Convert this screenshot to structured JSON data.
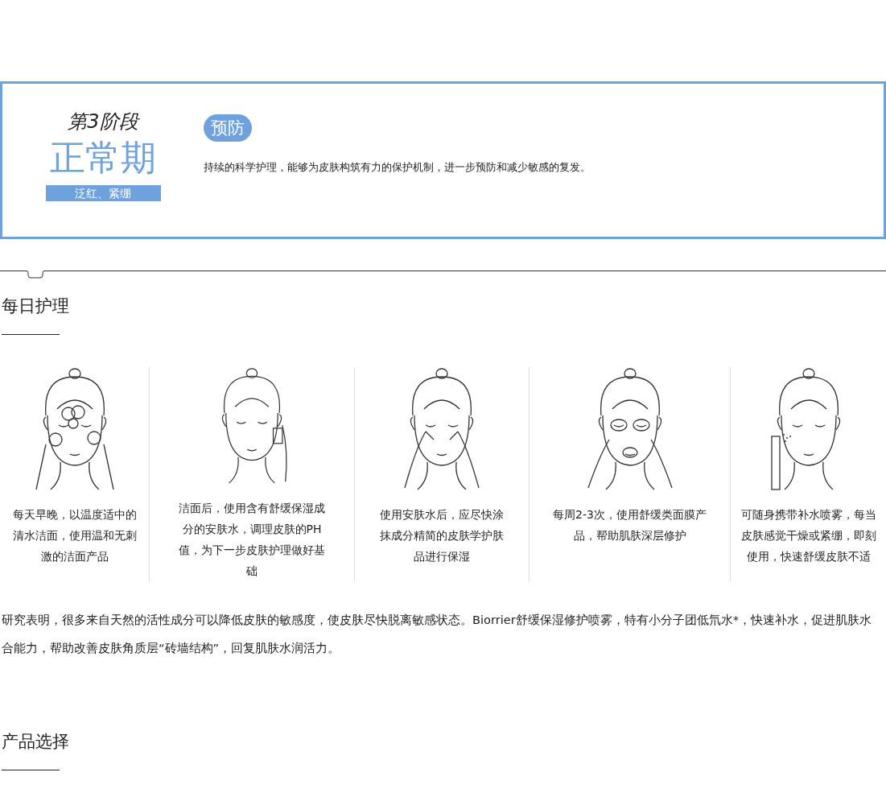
{
  "stage_card": {
    "stage_label": "第3阶段",
    "phase_title": "正常期",
    "symptoms_tag": "泛红、紧绷",
    "badge": "预防",
    "description": "持续的科学护理，能够为皮肤构筑有力的保护机制，进一步预防和减少敏感的复发。"
  },
  "daily_care": {
    "title": "每日护理",
    "steps": [
      {
        "kind": "cleanse",
        "text": "每天早晚，以温度适中的清水洁面，使用温和无刺激的洁面产品"
      },
      {
        "kind": "toner",
        "text": "洁面后，使用含有舒缓保湿成分的安肤水，调理皮肤的PH值，为下一步皮肤护理做好基础"
      },
      {
        "kind": "massage",
        "text": "使用安肤水后，应尽快涂抹成分精简的皮肤学护肤品进行保湿"
      },
      {
        "kind": "mask",
        "text": "每周2-3次，使用舒缓类面膜产品，帮助肌肤深层修护"
      },
      {
        "kind": "spray",
        "text": "可随身携带补水喷雾，每当皮肤感觉干燥或紧绷，即刻使用，快速舒缓皮肤不适"
      }
    ],
    "note": "研究表明，很多来自天然的活性成分可以降低皮肤的敏感度，使皮肤尽快脱离敏感状态。Biorrier舒缓保湿修护喷雾，特有小分子团低氘水*，快速补水，促进肌肤水合能力，帮助改善皮肤角质层“砖墙结构”，回复肌肤水润活力。"
  },
  "product_selection": {
    "title": "产品选择"
  }
}
